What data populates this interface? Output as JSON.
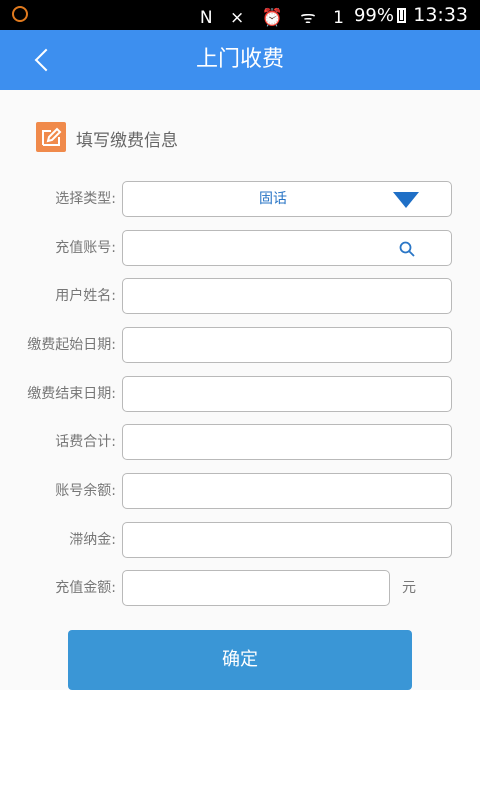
{
  "status_bar": {
    "icons": "N ⨯ ⏰ ᯤ 1",
    "battery": "99%",
    "time": "13:33"
  },
  "header": {
    "title": "上门收费",
    "back_icon": "chevron-left-icon"
  },
  "section": {
    "title": "填写缴费信息",
    "icon": "edit-icon"
  },
  "form": {
    "type_label": "选择类型:",
    "type_value": "固话",
    "account_label": "充值账号:",
    "name_label": "用户姓名:",
    "start_date_label": "缴费起始日期:",
    "end_date_label": "缴费结束日期:",
    "bill_total_label": "话费合计:",
    "balance_label": "账号余额:",
    "late_fee_label": "滞纳金:",
    "amount_label": "充值金额:",
    "amount_unit": "元"
  },
  "actions": {
    "confirm_label": "确定"
  },
  "colors": {
    "header_bg": "#3d8fef",
    "button_bg": "#3a96d6",
    "accent_icon": "#f08a4b",
    "select_text": "#2a76c6"
  }
}
